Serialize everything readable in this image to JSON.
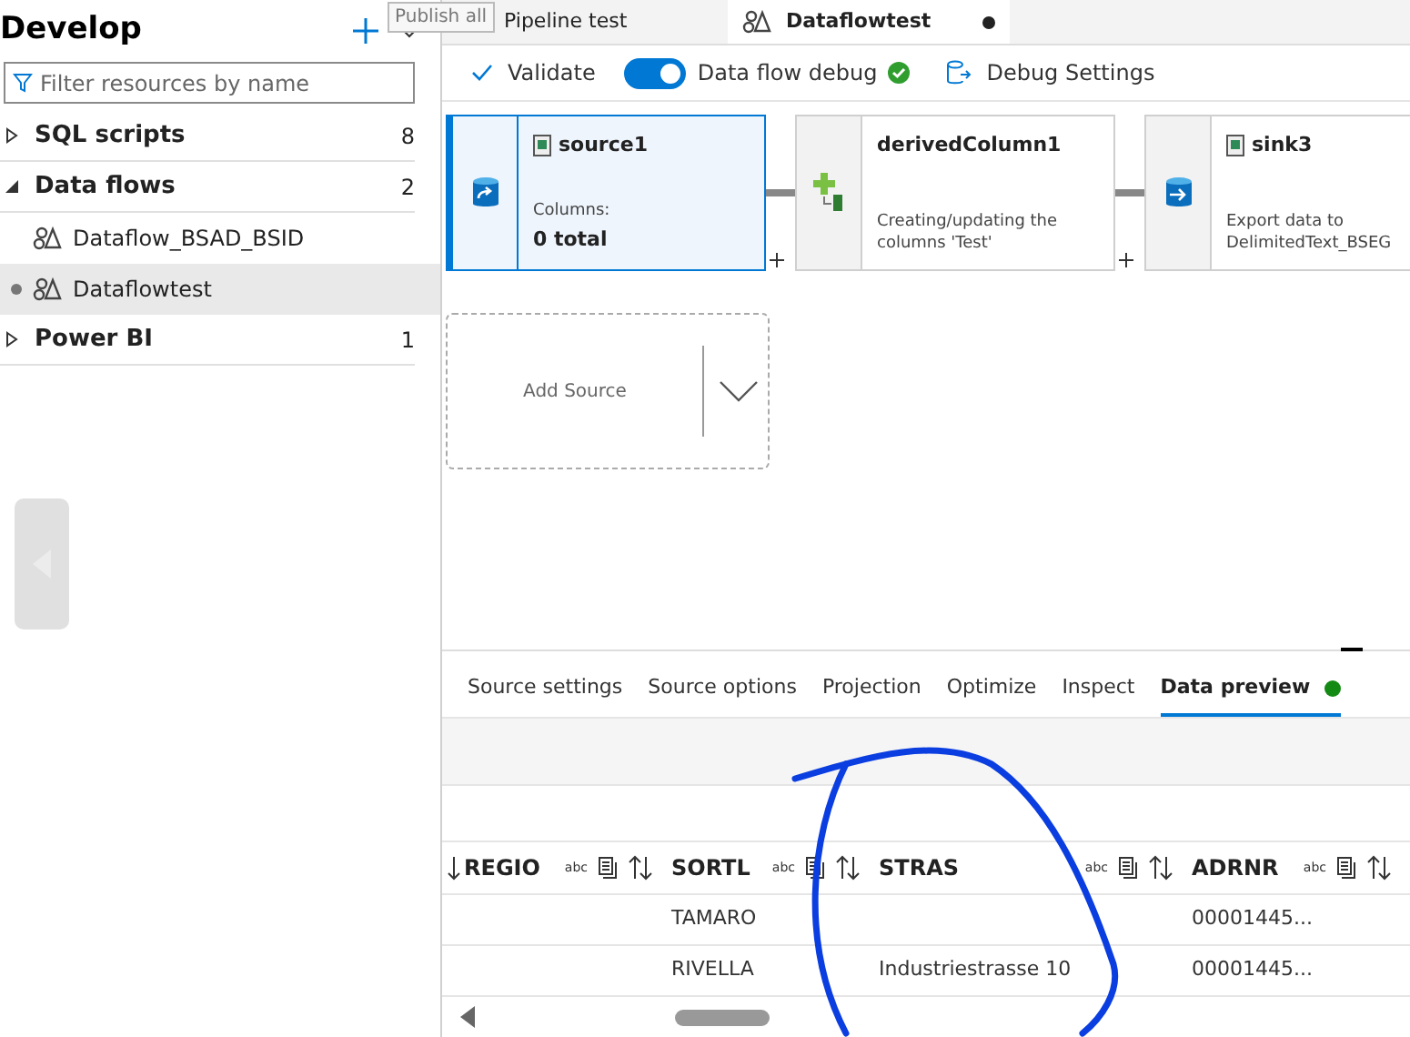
{
  "sidebar": {
    "title": "Develop",
    "filter_placeholder": "Filter resources by name",
    "items": [
      {
        "label": "SQL scripts",
        "count": "8",
        "expanded": false
      },
      {
        "label": "Data flows",
        "count": "2",
        "expanded": true,
        "children": [
          {
            "label": "Dataflow_BSAD_BSID",
            "selected": false,
            "unsaved": false
          },
          {
            "label": "Dataflowtest",
            "selected": true,
            "unsaved": true
          }
        ]
      },
      {
        "label": "Power BI",
        "count": "1",
        "expanded": false
      }
    ]
  },
  "tooltip": "Publish all",
  "tabs": [
    {
      "label": "Pipeline test",
      "selected": false,
      "unsaved": false,
      "icon": false
    },
    {
      "label": "Dataflowtest",
      "selected": true,
      "unsaved": true,
      "icon": true
    }
  ],
  "toolbar": {
    "validate": "Validate",
    "debug_label": "Data flow debug",
    "debug_on": true,
    "debug_ready": true,
    "debug_settings": "Debug Settings"
  },
  "nodes": [
    {
      "kind": "source",
      "title": "source1",
      "detail_label": "Columns:",
      "detail": "0 total",
      "selected": true
    },
    {
      "kind": "transform",
      "title": "derivedColumn1",
      "detail": "Creating/updating the columns 'Test'",
      "selected": false
    },
    {
      "kind": "sink",
      "title": "sink3",
      "detail": "Export data to DelimitedText_BSEG",
      "selected": false
    }
  ],
  "add_source": "Add Source",
  "panel_tabs": [
    {
      "label": "Source settings",
      "selected": false,
      "status": false
    },
    {
      "label": "Source options",
      "selected": false,
      "status": false
    },
    {
      "label": "Projection",
      "selected": false,
      "status": false
    },
    {
      "label": "Optimize",
      "selected": false,
      "status": false
    },
    {
      "label": "Inspect",
      "selected": false,
      "status": false
    },
    {
      "label": "Data preview",
      "selected": true,
      "status": true
    }
  ],
  "table": {
    "columns": [
      {
        "label": "REGIO",
        "type": "abc"
      },
      {
        "label": "SORTL",
        "type": "abc"
      },
      {
        "label": "STRAS",
        "type": "abc"
      },
      {
        "label": "ADRNR",
        "type": "abc"
      }
    ],
    "rows": [
      [
        null,
        "TAMARO",
        null,
        "00001445..."
      ],
      [
        null,
        "RIVELLA",
        "Industriestrasse 10",
        "00001445..."
      ]
    ]
  }
}
